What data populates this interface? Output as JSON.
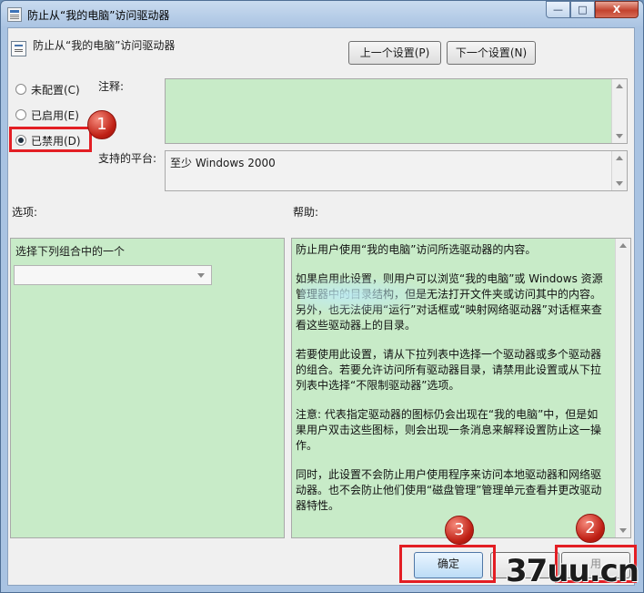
{
  "window": {
    "title": "防止从“我的电脑”访问驱动器",
    "close_symbol": "X",
    "min_symbol": "—",
    "max_symbol": "□"
  },
  "header": {
    "policy_name": "防止从“我的电脑”访问驱动器",
    "prev_button": "上一个设置(P)",
    "next_button": "下一个设置(N)"
  },
  "state": {
    "not_configured": "未配置(C)",
    "enabled": "已启用(E)",
    "disabled": "已禁用(D)",
    "selected": "disabled"
  },
  "comment": {
    "label": "注释:",
    "value": ""
  },
  "platform": {
    "label": "支持的平台:",
    "value": "至少 Windows 2000"
  },
  "options": {
    "label": "选项:",
    "combo_label": "选择下列组合中的一个",
    "combo_value": ""
  },
  "help": {
    "label": "帮助:",
    "paragraphs": [
      "防止用户使用“我的电脑”访问所选驱动器的内容。",
      "如果启用此设置，则用户可以浏览“我的电脑”或 Windows 资源管理器中的目录结构，但是无法打开文件夹或访问其中的内容。另外，也无法使用“运行”对话框或“映射网络驱动器”对话框来查看这些驱动器上的目录。",
      "若要使用此设置，请从下拉列表中选择一个驱动器或多个驱动器的组合。若要允许访问所有驱动器目录，请禁用此设置或从下拉列表中选择“不限制驱动器”选项。",
      "注意: 代表指定驱动器的图标仍会出现在“我的电脑”中，但是如果用户双击这些图标，则会出现一条消息来解释设置防止这一操作。",
      "同时，此设置不会防止用户使用程序来访问本地驱动器和网络驱动器。也不会防止他们使用“磁盘管理”管理单元查看并更改驱动器特性。"
    ]
  },
  "footer": {
    "ok_button": "确定",
    "cancel_button": "",
    "apply_button": "用"
  },
  "annotations": {
    "badge1": "1",
    "badge2": "2",
    "badge3": "3",
    "color": "#e31e24"
  },
  "watermark": "37uu.cn"
}
